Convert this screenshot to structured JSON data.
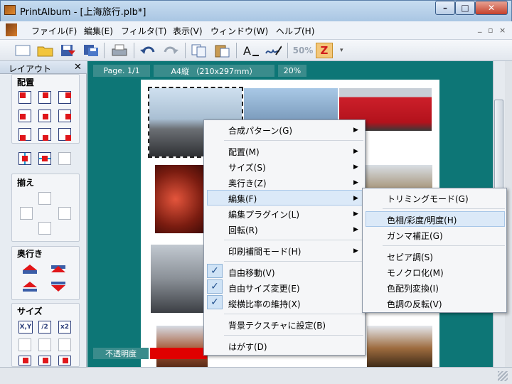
{
  "window": {
    "title": "PrintAlbum - [上海旅行.plb*]",
    "min": "–",
    "max": "□",
    "close": "✕"
  },
  "menubar": {
    "items": [
      "ファイル(F)",
      "編集(E)",
      "フィルタ(T)",
      "表示(V)",
      "ウィンドウ(W)",
      "ヘルプ(H)"
    ],
    "mdi": [
      "_",
      "▫",
      "×"
    ]
  },
  "toolbar": {
    "icons": [
      "new-icon",
      "open-folder-icon",
      "save-icon",
      "save-as-icon",
      "print-icon",
      "undo-icon",
      "redo-icon",
      "copy-icon",
      "paste-icon",
      "text-icon",
      "draw-icon",
      "zoom-50-icon",
      "zoom-fit-icon"
    ],
    "zoom50_label": "50%",
    "z_label": "Z",
    "overflow": "▾"
  },
  "panel": {
    "title": "レイアウト",
    "close": "✕",
    "groups": [
      "配置",
      "揃え",
      "奥行き",
      "サイズ"
    ],
    "size_labels": [
      "X,Y",
      "/2",
      "x2"
    ]
  },
  "canvas": {
    "page_label": "Page. 1/1",
    "paper_label": "A4縦 （210x297mm）",
    "zoom_label": "20%",
    "opacity_label": "不透明度",
    "opacity_color": "#e00000"
  },
  "context_menu": {
    "items": [
      {
        "label": "合成パターン(G)",
        "submenu": true
      },
      {
        "label": "配置(M)",
        "submenu": true
      },
      {
        "label": "サイズ(S)",
        "submenu": true
      },
      {
        "label": "奥行き(Z)",
        "submenu": true
      },
      {
        "label": "編集(F)",
        "submenu": true,
        "highlighted": true
      },
      {
        "label": "編集プラグイン(L)",
        "submenu": true
      },
      {
        "label": "回転(R)",
        "submenu": true
      },
      {
        "label": "印刷補間モード(H)",
        "submenu": true
      },
      {
        "label": "自由移動(V)",
        "checked": true
      },
      {
        "label": "自由サイズ変更(E)",
        "checked": true
      },
      {
        "label": "縦横比率の維持(X)",
        "checked": true
      },
      {
        "label": "背景テクスチャに設定(B)"
      },
      {
        "label": "はがす(D)"
      }
    ],
    "arrow": "▶",
    "check": "✓"
  },
  "submenu": {
    "items": [
      {
        "label": "トリミングモード(G)"
      },
      {
        "label": "色相/彩度/明度(H)",
        "highlighted": true
      },
      {
        "label": "ガンマ補正(G)"
      },
      {
        "label": "セピア調(S)"
      },
      {
        "label": "モノクロ化(M)"
      },
      {
        "label": "色配列変換(I)"
      },
      {
        "label": "色調の反転(V)"
      }
    ]
  },
  "colors": {
    "canvas_bg": "#0d7676",
    "accent": "#3a8c8c",
    "highlight": "#dbe9f8"
  }
}
